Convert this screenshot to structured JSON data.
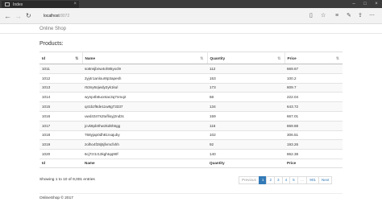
{
  "browser": {
    "tab_title": "Index",
    "url_host": "localhost",
    "url_port": ":8072",
    "icons": [
      "reading-view-icon",
      "favorites-icon",
      "favorites-hub-icon",
      "notes-icon",
      "share-icon",
      "more-icon"
    ]
  },
  "page": {
    "brand": "Online Shop",
    "heading": "Products:",
    "columns": [
      "Id",
      "Name",
      "Quantity",
      "Price"
    ],
    "rows": [
      [
        "1011",
        "so8nsjbnw4oh85yxcl9",
        "112",
        "669.67"
      ],
      [
        "1012",
        "2yj4r1anlour8p3apesh",
        "153",
        "100.2"
      ],
      [
        "1013",
        "r53ny6ojwdy2yk1kul",
        "173",
        "609.7"
      ],
      [
        "1014",
        "wynp4b8uontac3q7nmq2",
        "68",
        "222.04"
      ],
      [
        "1015",
        "q41bzf6de11w8g73337",
        "134",
        "643.72"
      ],
      [
        "1016",
        "uwd4347s2tuflioyj2nd3c",
        "159",
        "667.01"
      ],
      [
        "1017",
        "jcvk9pb0hw2kd6h6gg",
        "116",
        "869.88"
      ],
      [
        "1018",
        "768yjap0dh81rxajuby",
        "102",
        "306.51"
      ],
      [
        "1019",
        "zolho4f28j5jfvmcfxhh",
        "92",
        "193.26"
      ],
      [
        "1020",
        "6cj7zr1r13kghtqq90f",
        "140",
        "862.38"
      ]
    ],
    "info": "Showing 1 to 10 of 9,001 entries",
    "pager": {
      "previous": "Previous",
      "pages": [
        "1",
        "2",
        "3",
        "4",
        "5",
        "…",
        "901"
      ],
      "current": "1",
      "next": "Next"
    },
    "footer": "OnlineShop © 2017"
  },
  "colors": {
    "accent": "#337ab7",
    "tab_strip": "#3c3c3c"
  }
}
